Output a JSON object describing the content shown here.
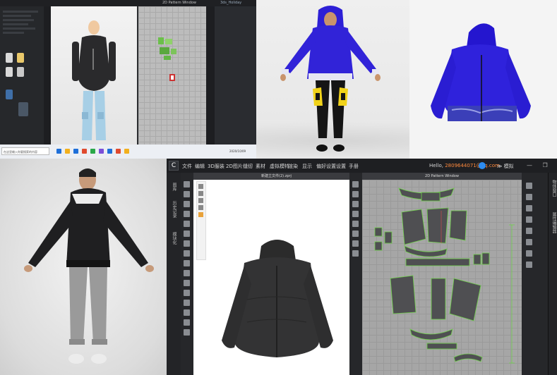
{
  "panel1": {
    "title_center": "2D Pattern Window",
    "title_right": "3ds_Holiday",
    "search_text": "在这里输入你要搜索的内容",
    "tray_time": "2020/10/09",
    "taskbar_icon_colors": [
      "#1e6fd9",
      "#f2b01e",
      "#1e6fd9",
      "#e04a2f",
      "#2aa84a",
      "#7b4fd8",
      "#1e6fd9",
      "#e04a2f",
      "#f2b01e"
    ]
  },
  "panel2": {},
  "panel3": {},
  "panel4": {
    "logo": "C",
    "menu": [
      "文件",
      "编辑",
      "3D服装",
      "2D图片",
      "缝纫",
      "素材",
      "虚拟模特",
      "渲染",
      "显示",
      "偏好设置",
      "设置",
      "手册"
    ],
    "user_prefix": "Hello, ",
    "user_email": "2809644071@qq.com",
    "mode_label": "模拟",
    "window_controls": "— ❐ ✕",
    "view3d_title": "新建立文件(2).zprj",
    "view2d_title": "2D Pattern Window",
    "left_vtabs": [
      "图库",
      "历史记录",
      "模块化"
    ],
    "right_vtabs": [
      "物体窗口",
      "属性编辑器"
    ]
  }
}
